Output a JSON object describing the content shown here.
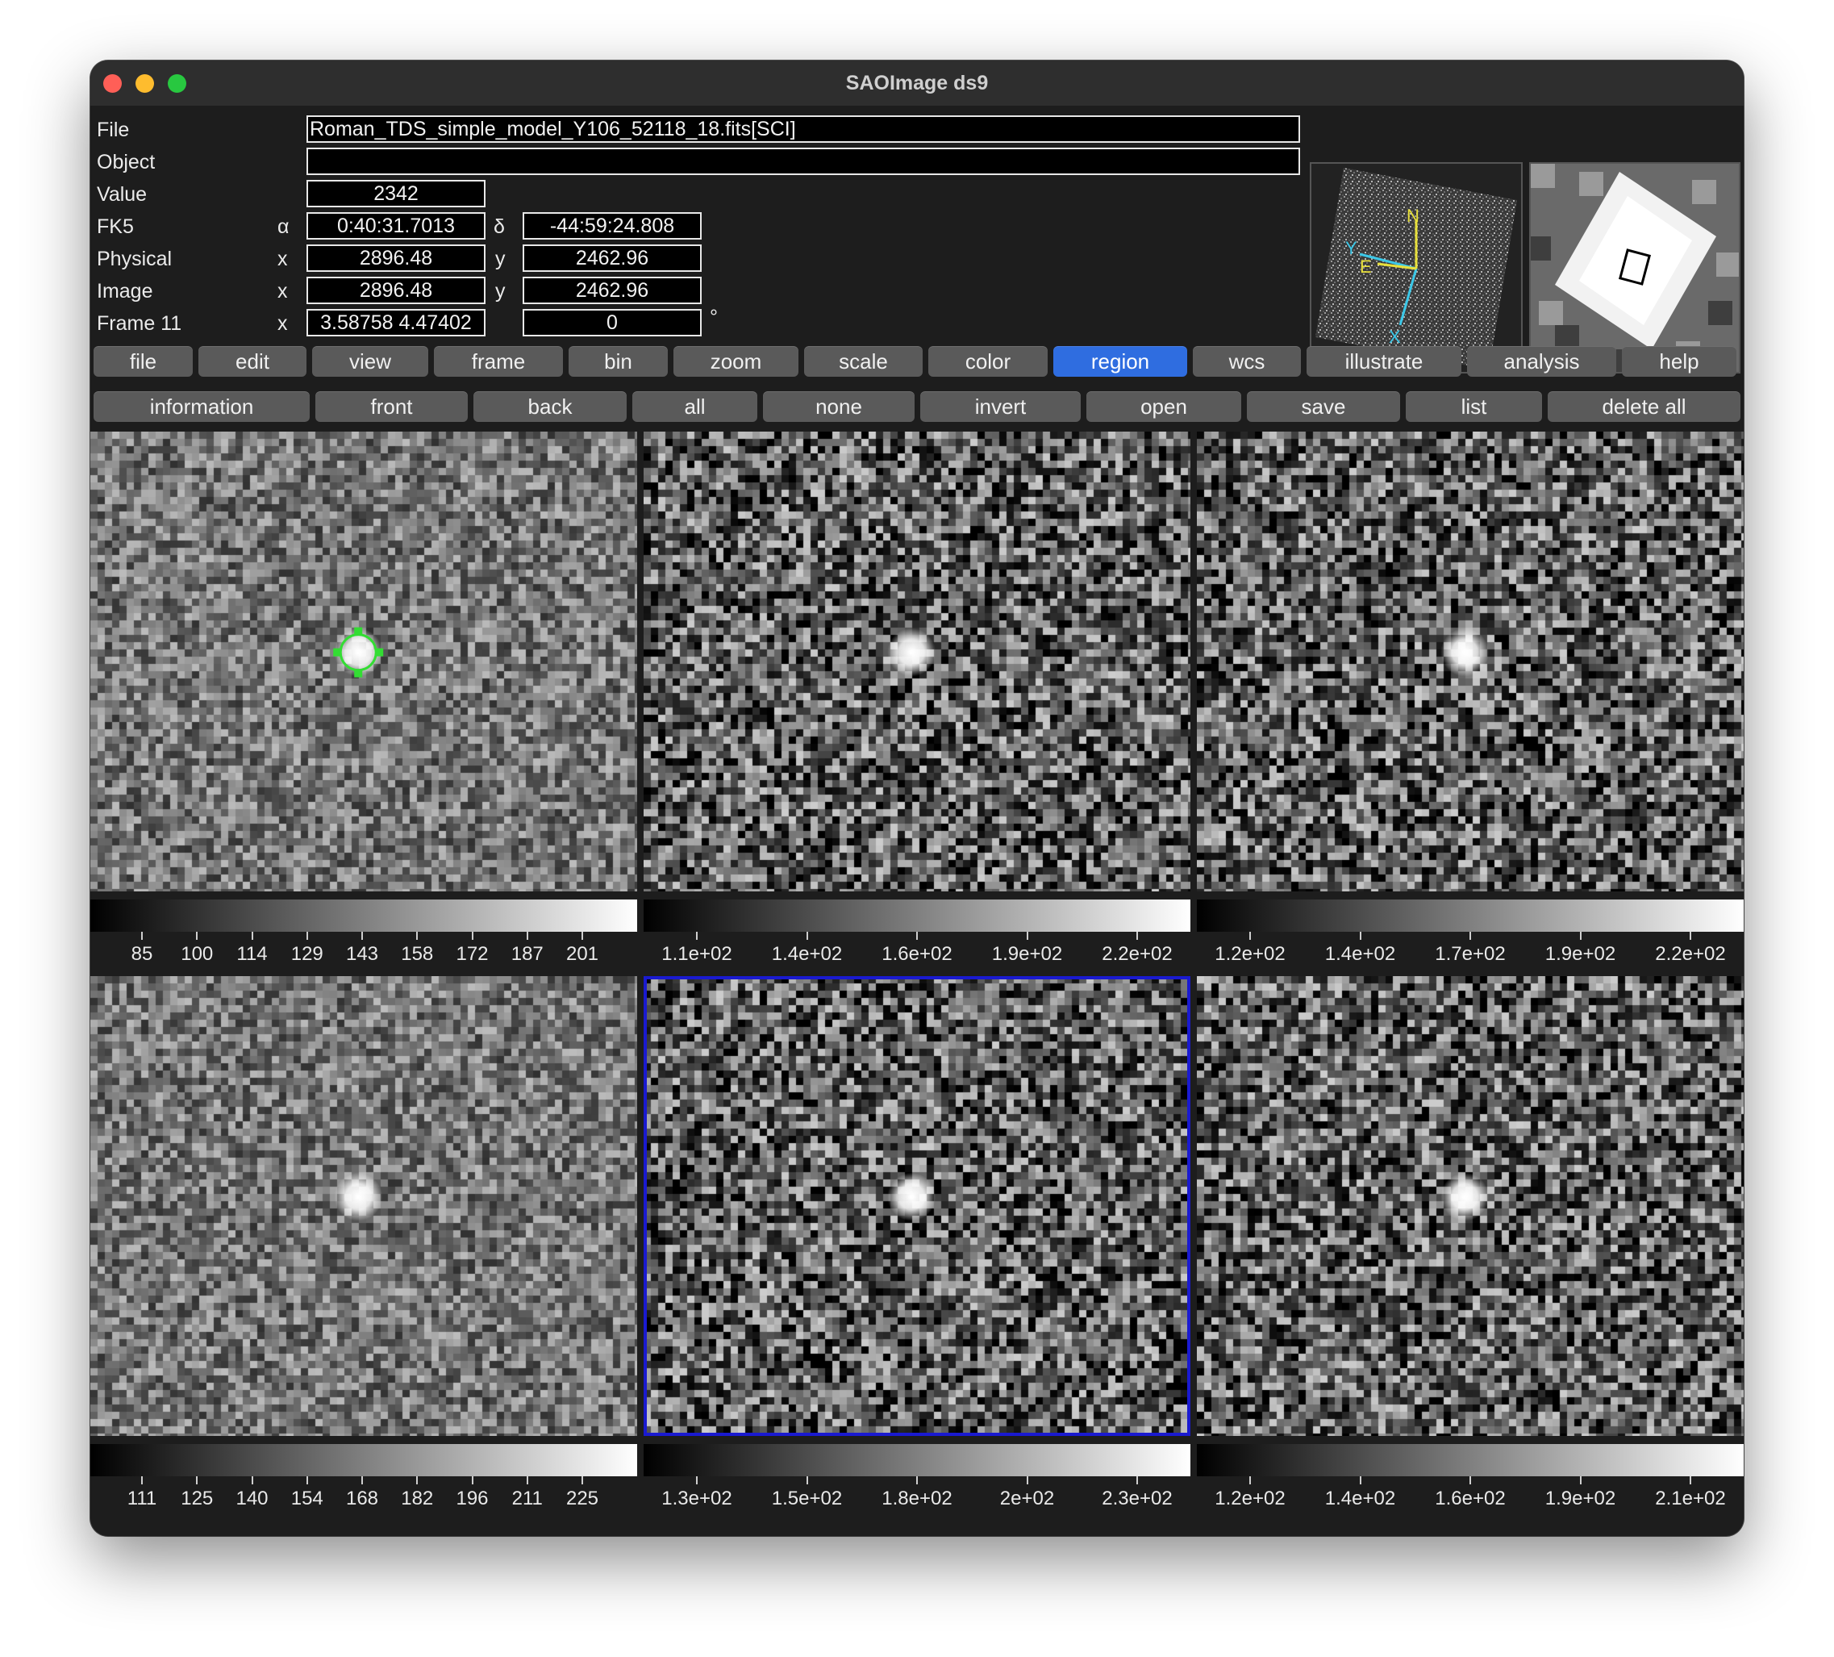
{
  "window": {
    "title": "SAOImage ds9"
  },
  "info": {
    "file": {
      "label": "File",
      "value": "Roman_TDS_simple_model_Y106_52118_18.fits[SCI]"
    },
    "object": {
      "label": "Object",
      "value": ""
    },
    "value": {
      "label": "Value",
      "value": "2342"
    },
    "fk5": {
      "label": "FK5",
      "alpha_sym": "α",
      "alpha": "0:40:31.7013",
      "delta_sym": "δ",
      "delta": "-44:59:24.808"
    },
    "physical": {
      "label": "Physical",
      "x_sym": "x",
      "x": "2896.48",
      "y_sym": "y",
      "y": "2462.96"
    },
    "image": {
      "label": "Image",
      "x_sym": "x",
      "x": "2896.48",
      "y_sym": "y",
      "y": "2462.96"
    },
    "frame": {
      "label": "Frame 11",
      "x_sym": "x",
      "zoom": "3.58758 4.47402",
      "angle": "0",
      "degree_sym": "°"
    }
  },
  "panner": {
    "compass": {
      "north": "N",
      "east": "E",
      "x_axis": "X",
      "y_axis": "Y"
    }
  },
  "menu": {
    "items": [
      "file",
      "edit",
      "view",
      "frame",
      "bin",
      "zoom",
      "scale",
      "color",
      "region",
      "wcs",
      "illustrate",
      "analysis",
      "help"
    ],
    "active": "region"
  },
  "region_buttons": [
    "information",
    "front",
    "back",
    "all",
    "none",
    "invert",
    "open",
    "save",
    "list",
    "delete all"
  ],
  "colors": {
    "active_button": "#2f6de0",
    "region_marker": "#33dd33",
    "current_frame": "#1a1ad0",
    "compass_cyan": "#3cc8e8",
    "compass_yellow": "#e8e03c"
  },
  "frames": [
    {
      "colorbar_labels": [
        "85",
        "100",
        "114",
        "129",
        "143",
        "158",
        "172",
        "187",
        "201"
      ],
      "has_region": true,
      "current": false
    },
    {
      "colorbar_labels": [
        "1.1e+02",
        "1.4e+02",
        "1.6e+02",
        "1.9e+02",
        "2.2e+02"
      ],
      "has_region": false,
      "current": false
    },
    {
      "colorbar_labels": [
        "1.2e+02",
        "1.4e+02",
        "1.7e+02",
        "1.9e+02",
        "2.2e+02"
      ],
      "has_region": false,
      "current": false
    },
    {
      "colorbar_labels": [
        "111",
        "125",
        "140",
        "154",
        "168",
        "182",
        "196",
        "211",
        "225"
      ],
      "has_region": false,
      "current": false
    },
    {
      "colorbar_labels": [
        "1.3e+02",
        "1.5e+02",
        "1.8e+02",
        "2e+02",
        "2.3e+02"
      ],
      "has_region": false,
      "current": true
    },
    {
      "colorbar_labels": [
        "1.2e+02",
        "1.4e+02",
        "1.6e+02",
        "1.9e+02",
        "2.1e+02"
      ],
      "has_region": false,
      "current": false
    }
  ]
}
